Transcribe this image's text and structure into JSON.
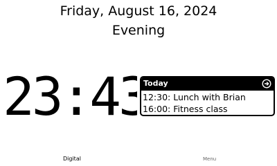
{
  "header": {
    "date": "Friday, August 16, 2024",
    "period": "Evening"
  },
  "clock": {
    "time": "23:43"
  },
  "agenda": {
    "title": "Today",
    "open_icon": "circle-arrow-right-icon",
    "items": [
      {
        "text": "12:30: Lunch with Brian"
      },
      {
        "text": "16:00: Fitness class"
      }
    ]
  },
  "footer": {
    "tabs": [
      {
        "label": "Digital"
      },
      {
        "label": "Menu"
      }
    ]
  },
  "colors": {
    "background": "#ffffff",
    "foreground": "#000000",
    "agenda_header_bg": "#000000",
    "agenda_header_fg": "#ffffff"
  }
}
